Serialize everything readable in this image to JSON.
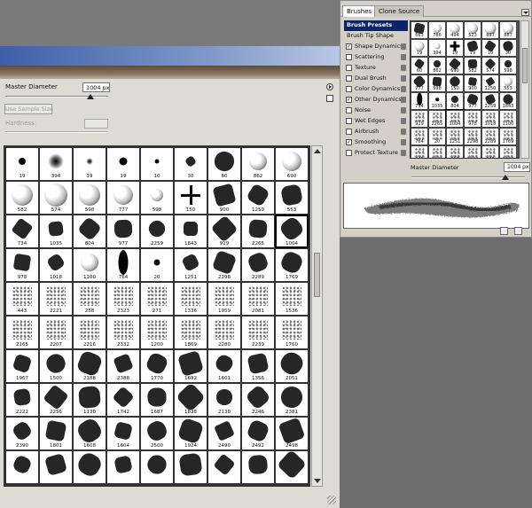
{
  "picker": {
    "master_diameter_label": "Master Diameter",
    "master_diameter_value": "1004 px",
    "master_diameter_level": 0.83,
    "use_sample_size_label": "Use Sample Size",
    "hardness_label": "Hardness:",
    "brush_rows": [
      [
        "19",
        "394",
        "19",
        "19",
        "10",
        "30",
        "60",
        "862",
        "690"
      ],
      [
        "582",
        "574",
        "598",
        "777",
        "598",
        "150",
        "900",
        "1250",
        "553"
      ],
      [
        "734",
        "1035",
        "804",
        "977",
        "2259",
        "1843",
        "919",
        "2265",
        "1004"
      ],
      [
        "978",
        "1018",
        "1100",
        "764",
        "20",
        "1251",
        "2298",
        "2289",
        "1769"
      ],
      [
        "443",
        "2221",
        "258",
        "2323",
        "271",
        "1336",
        "1959",
        "2081",
        "1536"
      ],
      [
        "2165",
        "2207",
        "2216",
        "2332",
        "1200",
        "1869",
        "2280",
        "2239",
        "1760"
      ],
      [
        "1967",
        "1500",
        "2188",
        "2388",
        "1770",
        "1692",
        "1601",
        "1356",
        "2051"
      ],
      [
        "2222",
        "2256",
        "1130",
        "1742",
        "1687",
        "1838",
        "2130",
        "2246",
        "2381"
      ],
      [
        "2390",
        "1801",
        "1608",
        "1604",
        "2500",
        "1924",
        "2490",
        "2492",
        "2498"
      ],
      [
        "",
        "",
        "",
        "",
        "",
        "",
        "",
        "",
        ""
      ]
    ],
    "selected_brush": "1004"
  },
  "panel": {
    "tab_brushes": "Brushes",
    "tab_close": "×",
    "tab_clone_source": "Clone Source",
    "options": [
      {
        "label": "Brush Presets",
        "kind": "header"
      },
      {
        "label": "Brush Tip Shape",
        "kind": "plain"
      },
      {
        "label": "Shape Dynamics",
        "kind": "check",
        "checked": "✓"
      },
      {
        "label": "Scattering",
        "kind": "check",
        "checked": ""
      },
      {
        "label": "Texture",
        "kind": "check",
        "checked": ""
      },
      {
        "label": "Dual Brush",
        "kind": "check",
        "checked": ""
      },
      {
        "label": "Color Dynamics",
        "kind": "check",
        "checked": ""
      },
      {
        "label": "Other Dynamics",
        "kind": "check",
        "checked": "✓"
      },
      {
        "label": "Noise",
        "kind": "check",
        "checked": ""
      },
      {
        "label": "Wet Edges",
        "kind": "check",
        "checked": ""
      },
      {
        "label": "Airbrush",
        "kind": "check",
        "checked": ""
      },
      {
        "label": "Smoothing",
        "kind": "check",
        "checked": "✓"
      },
      {
        "label": "Protect Texture",
        "kind": "check",
        "checked": ""
      }
    ],
    "mini_rows": [
      [
        "663",
        "786",
        "494",
        "523",
        "897",
        "887"
      ],
      [
        "19",
        "394",
        "19",
        "19",
        "10",
        "30"
      ],
      [
        "60",
        "862",
        "690",
        "582",
        "574",
        "598"
      ],
      [
        "777",
        "598",
        "150",
        "900",
        "1250",
        "553"
      ],
      [
        "734",
        "1035",
        "804",
        "977",
        "2259",
        "1843"
      ],
      [
        "919",
        "2265",
        "1004",
        "978",
        "1018",
        "1100"
      ],
      [
        "764",
        "20",
        "1251",
        "2298",
        "2289",
        "1769"
      ],
      [
        "443",
        "2221",
        "258",
        "2323",
        "271",
        "1336"
      ],
      [
        "1959",
        "2081",
        "1536",
        "2165",
        "2207",
        "2216"
      ]
    ],
    "master_diameter_label": "Master Diameter",
    "master_diameter_value": "1004 px",
    "master_diameter_level": 0.83
  }
}
